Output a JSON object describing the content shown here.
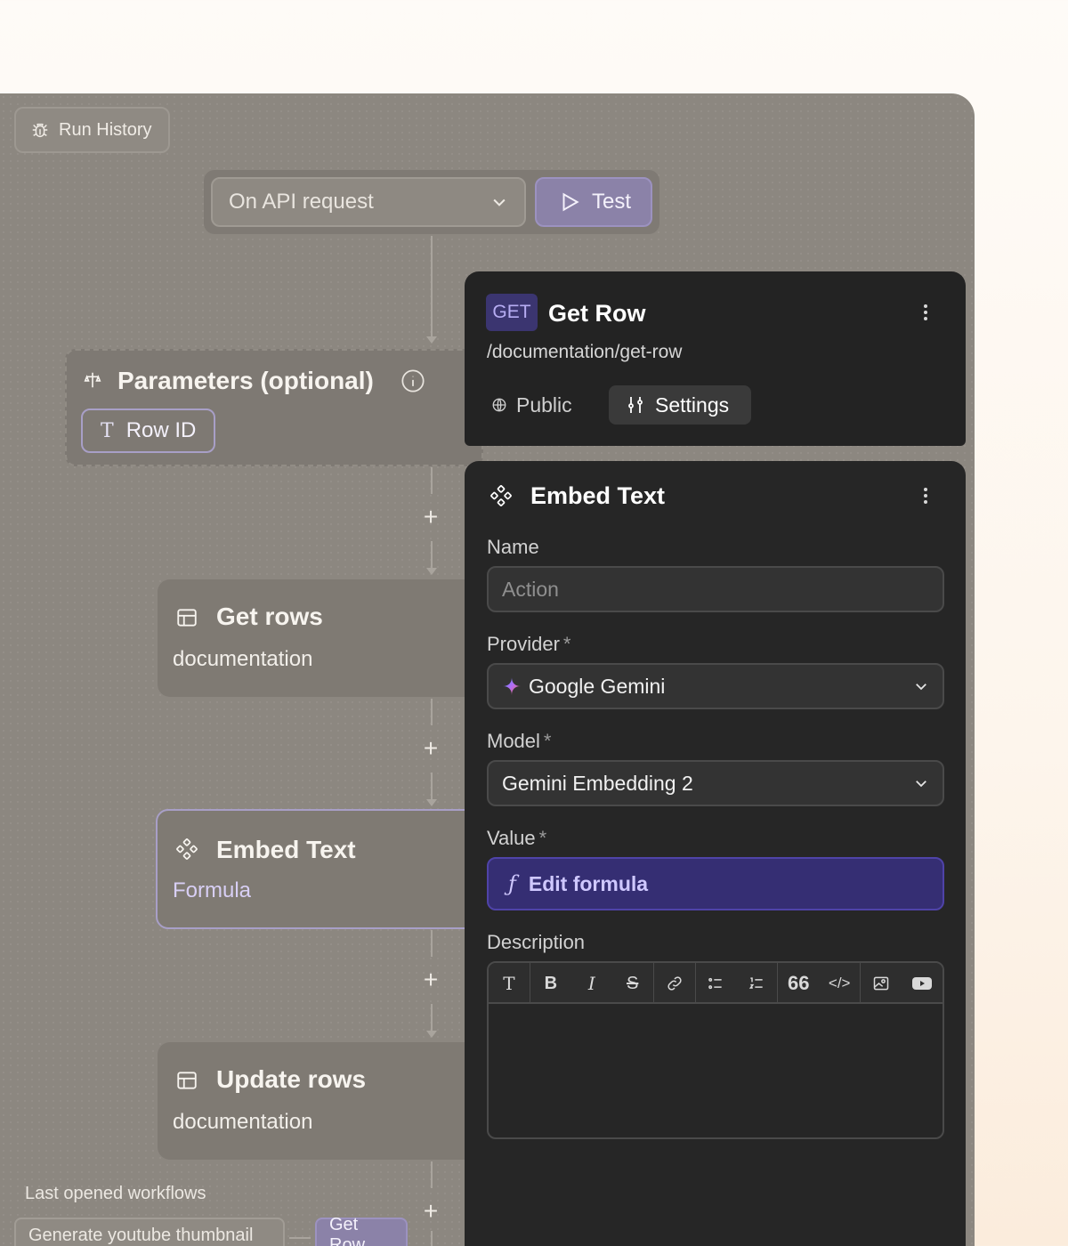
{
  "canvas": {
    "run_history_label": "Run History",
    "trigger": {
      "selected": "On API request",
      "test_label": "Test"
    },
    "parameters": {
      "title": "Parameters (optional)",
      "chip_label": "Row ID"
    },
    "nodes": [
      {
        "title": "Get rows",
        "subtitle": "documentation",
        "icon": "table-icon"
      },
      {
        "title": "Embed Text",
        "subtitle": "Formula",
        "icon": "embed-icon"
      },
      {
        "title": "Update rows",
        "subtitle": "documentation",
        "icon": "table-icon"
      }
    ],
    "last_opened": {
      "label": "Last opened workflows",
      "items": [
        "Generate youtube thumbnail",
        "Get Row"
      ]
    }
  },
  "panel": {
    "method": "GET",
    "title": "Get Row",
    "path": "/documentation/get-row",
    "tabs": {
      "public": "Public",
      "settings": "Settings"
    }
  },
  "form": {
    "title": "Embed Text",
    "name_label": "Name",
    "name_placeholder": "Action",
    "provider_label": "Provider",
    "provider_value": "Google Gemini",
    "model_label": "Model",
    "model_value": "Gemini Embedding 2",
    "value_label": "Value",
    "formula_label": "Edit formula",
    "description_label": "Description",
    "required_mark": "*"
  },
  "toolbar_icons": [
    "text-icon",
    "bold-icon",
    "italic-icon",
    "strikethrough-icon",
    "link-icon",
    "bullet-list-icon",
    "numbered-list-icon",
    "quote-icon",
    "code-icon",
    "image-icon",
    "video-icon"
  ],
  "colors": {
    "accent": "#352e73",
    "accent_text": "#cfc8ff",
    "panel_bg": "#262626"
  }
}
